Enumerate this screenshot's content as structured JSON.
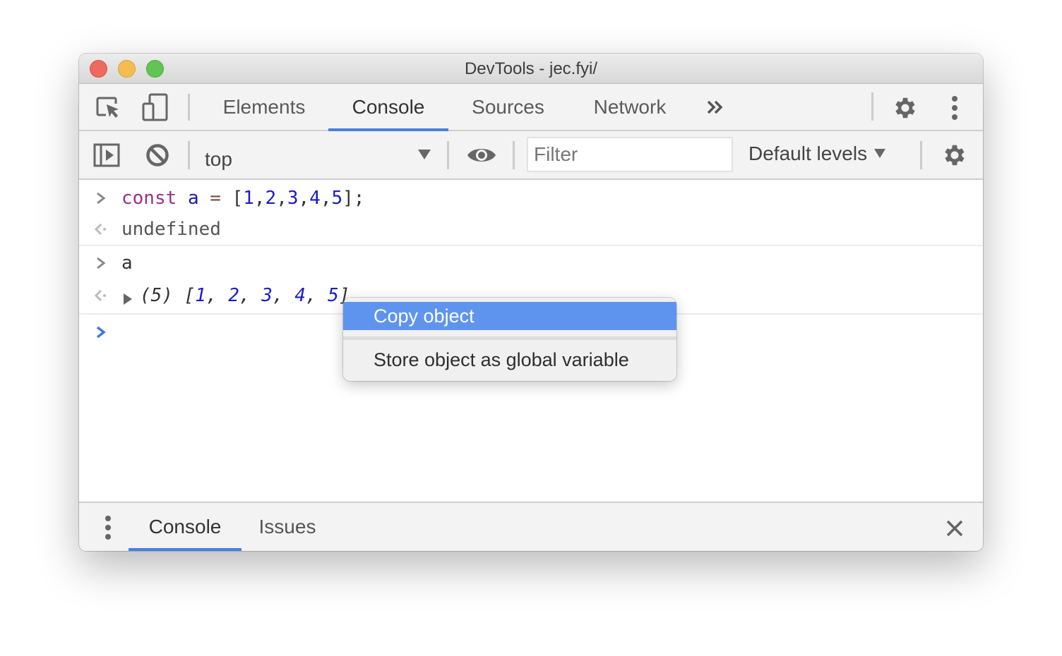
{
  "window": {
    "title": "DevTools - jec.fyi/"
  },
  "main_toolbar": {
    "tabs": [
      {
        "label": "Elements",
        "active": false
      },
      {
        "label": "Console",
        "active": true
      },
      {
        "label": "Sources",
        "active": false
      },
      {
        "label": "Network",
        "active": false
      }
    ],
    "icons": [
      "inspect-element-icon",
      "device-toolbar-icon",
      "more-tabs-icon",
      "settings-gear-icon",
      "more-options-icon"
    ]
  },
  "console_toolbar": {
    "context": "top",
    "filter_placeholder": "Filter",
    "filter_value": "",
    "levels_label": "Default levels",
    "icons": [
      "show-sidebar-icon",
      "clear-console-icon",
      "chevron-down-icon",
      "live-expression-eye-icon",
      "console-settings-gear-icon"
    ]
  },
  "console": {
    "entries": [
      {
        "type": "input",
        "tokens": [
          {
            "text": "const",
            "cls": "kw"
          },
          {
            "text": " ",
            "cls": "plain"
          },
          {
            "text": "a",
            "cls": "var"
          },
          {
            "text": " ",
            "cls": "plain"
          },
          {
            "text": "=",
            "cls": "op"
          },
          {
            "text": " [",
            "cls": "plain"
          },
          {
            "text": "1",
            "cls": "num"
          },
          {
            "text": ",",
            "cls": "plain"
          },
          {
            "text": "2",
            "cls": "num"
          },
          {
            "text": ",",
            "cls": "plain"
          },
          {
            "text": "3",
            "cls": "num"
          },
          {
            "text": ",",
            "cls": "plain"
          },
          {
            "text": "4",
            "cls": "num"
          },
          {
            "text": ",",
            "cls": "plain"
          },
          {
            "text": "5",
            "cls": "num"
          },
          {
            "text": "];",
            "cls": "plain"
          }
        ]
      },
      {
        "type": "output",
        "tokens": [
          {
            "text": "undefined",
            "cls": "undef"
          }
        ]
      },
      {
        "type": "input",
        "tokens": [
          {
            "text": "a",
            "cls": "plain"
          }
        ]
      },
      {
        "type": "output",
        "expandable": true,
        "tokens": [
          {
            "text": "(5) [",
            "cls": "plain italic"
          },
          {
            "text": "1",
            "cls": "num italic"
          },
          {
            "text": ", ",
            "cls": "plain italic"
          },
          {
            "text": "2",
            "cls": "num italic"
          },
          {
            "text": ", ",
            "cls": "plain italic"
          },
          {
            "text": "3",
            "cls": "num italic"
          },
          {
            "text": ", ",
            "cls": "plain italic"
          },
          {
            "text": "4",
            "cls": "num italic"
          },
          {
            "text": ", ",
            "cls": "plain italic"
          },
          {
            "text": "5",
            "cls": "num italic"
          },
          {
            "text": "]",
            "cls": "plain italic"
          }
        ]
      }
    ],
    "prompt_value": ""
  },
  "context_menu": {
    "items": [
      {
        "label": "Copy object",
        "highlighted": true
      },
      {
        "label": "Store object as global variable",
        "highlighted": false
      }
    ]
  },
  "drawer": {
    "tabs": [
      {
        "label": "Console",
        "active": true
      },
      {
        "label": "Issues",
        "active": false
      }
    ],
    "icons": [
      "drawer-menu-icon",
      "close-drawer-icon"
    ]
  },
  "colors": {
    "accent": "#4a7fe0",
    "menu_highlight": "#5f94ee",
    "keyword": "#9a2f8e",
    "number": "#1c1cc7",
    "prompt": "#3b78e7"
  }
}
